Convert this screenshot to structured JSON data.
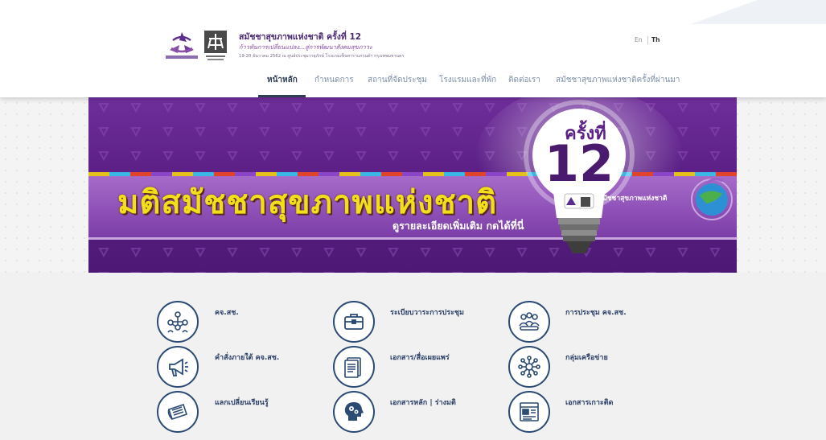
{
  "header": {
    "title": "สมัชชาสุขภาพแห่งชาติ ครั้งที่ 12",
    "subtitle": "ก้าวทันการเปลี่ยนแปลง...สู่การพัฒนาสังคมสุขภาวะ",
    "meta": "19-20 ธันวาคม 2562 ณ ศูนย์ประชุมวายุภักษ์ โรงแรมเซ็นทาราแกรนด์ฯ กรุงเทพมหานคร",
    "lang_en": "En",
    "lang_th": "Th"
  },
  "nav": {
    "items": [
      {
        "label": "หน้าหลัก",
        "active": true
      },
      {
        "label": "กำหนดการ",
        "active": false
      },
      {
        "label": "สถานที่จัดประชุม",
        "active": false
      },
      {
        "label": "โรงแรมและที่พัก",
        "active": false
      },
      {
        "label": "ติดต่อเรา",
        "active": false
      },
      {
        "label": "สมัชชาสุขภาพแห่งชาติครั้งที่ผ่านมา",
        "active": false
      }
    ]
  },
  "banner": {
    "headline": "มติสมัชชาสุขภาพแห่งชาติ",
    "more": "ดูรายละเอียดเพิ่มเติม กดได้ที่นี่",
    "bulb_word": "ครั้งที่",
    "bulb_number": "12",
    "bulb_caption": "สมัชชาสุขภาพแห่งชาติ"
  },
  "tiles": [
    {
      "label": "คจ.สช.",
      "icon": "people-network-icon"
    },
    {
      "label": "ระเบียบวาระการประชุม",
      "icon": "briefcase-icon"
    },
    {
      "label": "การประชุม คจ.สช.",
      "icon": "meeting-group-icon"
    },
    {
      "label": "คำสั่งภายใต้ คจ.สช.",
      "icon": "megaphone-icon"
    },
    {
      "label": "เอกสาร/สื่อเผยแพร่",
      "icon": "document-icon"
    },
    {
      "label": "กลุ่มเครือข่าย",
      "icon": "network-hub-icon"
    },
    {
      "label": "แลกเปลี่ยนเรียนรู้",
      "icon": "newspaper-roll-icon"
    },
    {
      "label": "เอกสารหลัก | ร่างมติ",
      "icon": "head-gears-icon"
    },
    {
      "label": "เอกสารเกาะติด",
      "icon": "news-board-icon"
    }
  ],
  "colors": {
    "banner_purple": "#5b1f85",
    "headline_yellow": "#f2df1a",
    "icon_navy": "#2b4a74"
  }
}
